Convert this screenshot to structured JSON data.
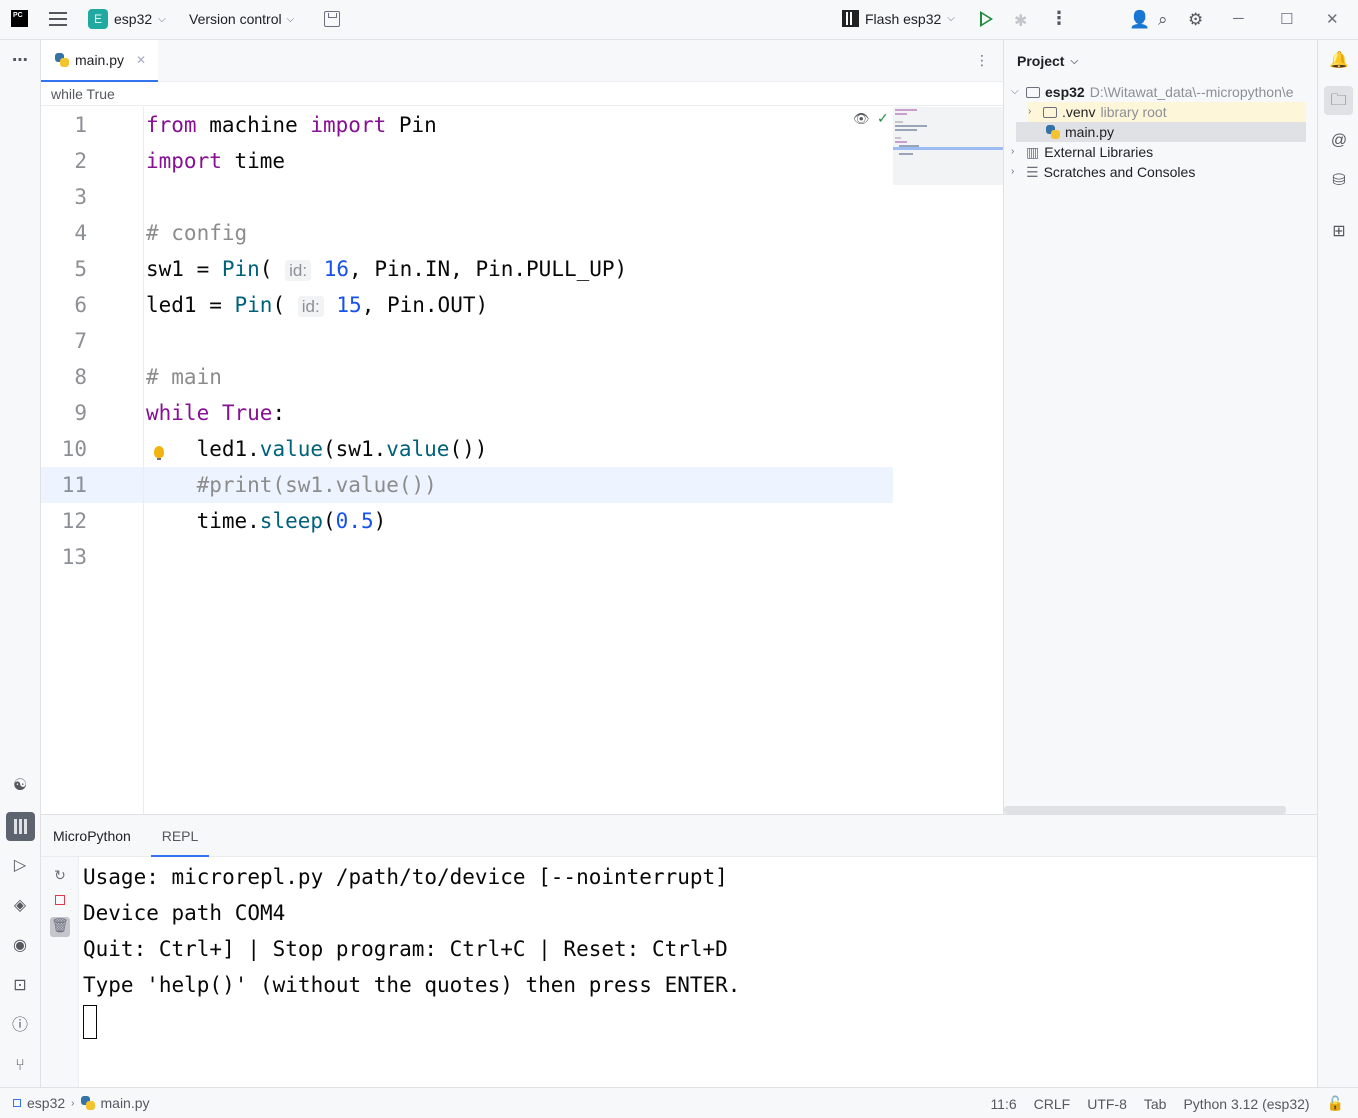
{
  "titlebar": {
    "project_badge": "E",
    "project_name": "esp32",
    "vcs_label": "Version control",
    "run_config": "Flash esp32"
  },
  "editor": {
    "tab_label": "main.py",
    "breadcrumb": "while True",
    "line_numbers": [
      "1",
      "2",
      "3",
      "4",
      "5",
      "6",
      "7",
      "8",
      "9",
      "10",
      "11",
      "12",
      "13"
    ],
    "code": {
      "l1_kw1": "from",
      "l1_mod": " machine ",
      "l1_kw2": "import",
      "l1_name": " Pin",
      "l2_kw": "import",
      "l2_mod": " time",
      "l4_comment": "# config",
      "l5_a": "sw1 = ",
      "l5_fn": "Pin",
      "l5_p": "(",
      "l5_hint": "id:",
      "l5_num": "16",
      "l5_rest": ", Pin.IN, Pin.PULL_UP)",
      "l6_a": "led1 = ",
      "l6_fn": "Pin",
      "l6_p": "(",
      "l6_hint": "id:",
      "l6_num": "15",
      "l6_rest": ", Pin.OUT)",
      "l8_comment": "# main",
      "l9_kw1": "while",
      "l9_kw2": " True",
      "l9_colon": ":",
      "l10_a": "    led1.",
      "l10_fn1": "value",
      "l10_b": "(sw1.",
      "l10_fn2": "value",
      "l10_c": "())",
      "l11_comment": "    #print(sw1.value())",
      "l12_a": "    time.",
      "l12_fn": "sleep",
      "l12_b": "(",
      "l12_num": "0.5",
      "l12_c": ")"
    }
  },
  "project": {
    "header": "Project",
    "root_name": "esp32",
    "root_path": "D:\\Witawat_data\\--micropython\\e",
    "venv_name": ".venv",
    "venv_note": "library root",
    "file_main": "main.py",
    "ext_libs": "External Libraries",
    "scratches": "Scratches and Consoles"
  },
  "bottom": {
    "title": "MicroPython",
    "tab": "REPL",
    "console_lines": [
      "Usage: microrepl.py /path/to/device [--nointerrupt]",
      "Device path COM4",
      "Quit: Ctrl+] | Stop program: Ctrl+C | Reset: Ctrl+D",
      "Type 'help()' (without the quotes) then press ENTER."
    ]
  },
  "statusbar": {
    "crumb_project": "esp32",
    "crumb_file": "main.py",
    "position": "11:6",
    "line_sep": "CRLF",
    "encoding": "UTF-8",
    "indent": "Tab",
    "interpreter": "Python 3.12 (esp32)"
  },
  "icons": {
    "menu": "hamburger-icon",
    "save": "save-icon",
    "run": "run-icon",
    "debug": "debug-icon",
    "add_user": "add-user-icon",
    "search": "search-icon",
    "settings": "gear-icon",
    "notifications": "bell-icon",
    "project": "folder-icon"
  },
  "colors": {
    "accent": "#3574f0",
    "keyword": "#871094",
    "number": "#1750eb",
    "comment": "#8c8c8c",
    "call": "#00627a",
    "run_green": "#208a3c"
  }
}
